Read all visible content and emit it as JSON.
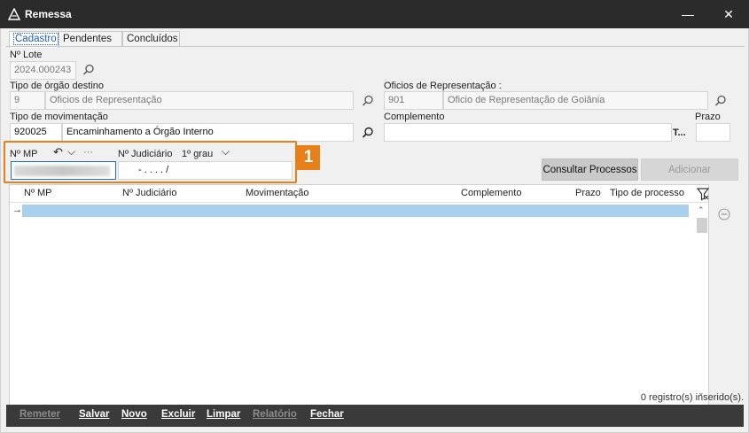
{
  "window": {
    "title": "Remessa",
    "minimize_glyph": "—",
    "close_glyph": "✕"
  },
  "tabs": [
    {
      "label": "Cadastro",
      "active": true
    },
    {
      "label": "Pendentes",
      "active": false
    },
    {
      "label": "Concluídos",
      "active": false
    }
  ],
  "form": {
    "lote": {
      "label": "Nº Lote",
      "value": "2024.000243"
    },
    "orgao_destino": {
      "label": "Tipo de órgão destino",
      "code": "9",
      "name": "Oficios de Representação"
    },
    "oficios": {
      "label": "Oficios de Representação :",
      "code": "901",
      "name": "Oficio de Representação de Goiânia"
    },
    "movimentacao": {
      "label": "Tipo de movimentação",
      "code": "920025",
      "name": "Encaminhamento a Órgão Interno"
    },
    "complemento": {
      "label": "Complemento",
      "value": "",
      "suffix": "T..."
    },
    "prazo": {
      "label": "Prazo",
      "value": ""
    },
    "mp": {
      "label": "Nº MP",
      "undo_glyph": "↶",
      "chevron_glyph": "⌵",
      "more_glyph": "···",
      "value": ""
    },
    "judiciario": {
      "label": "Nº Judiciário",
      "grau": "1º grau",
      "chevron_glyph": "⌵",
      "value": "- .  . . .  /"
    }
  },
  "highlight": {
    "badge": "1",
    "color": "#e8801a"
  },
  "buttons": {
    "consultar": "Consultar Processos",
    "adicionar": "Adicionar"
  },
  "grid": {
    "columns": [
      "Nº MP",
      "Nº Judiciário",
      "Movimentação",
      "Complemento",
      "Prazo",
      "Tipo de processo"
    ],
    "row_arrow": "→",
    "scroll_up": "⌃",
    "scroll_down": "⌄"
  },
  "status_text": "0 registro(s) inserido(s).",
  "toolbar": [
    {
      "label": "Remeter",
      "enabled": false
    },
    {
      "label": "Salvar",
      "enabled": true
    },
    {
      "label": "Novo",
      "enabled": true
    },
    {
      "label": "Excluir",
      "enabled": true
    },
    {
      "label": "Limpar",
      "enabled": true
    },
    {
      "label": "Relatório",
      "enabled": false
    },
    {
      "label": "Fechar",
      "enabled": true
    }
  ]
}
